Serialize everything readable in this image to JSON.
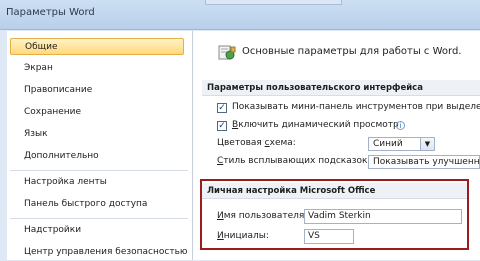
{
  "window": {
    "title": "Параметры Word"
  },
  "sidebar": {
    "items": [
      {
        "label": "Общие",
        "active": true
      },
      {
        "label": "Экран"
      },
      {
        "label": "Правописание"
      },
      {
        "label": "Сохранение"
      },
      {
        "label": "Язык"
      },
      {
        "label": "Дополнительно"
      },
      {
        "label": "Настройка ленты"
      },
      {
        "label": "Панель быстрого доступа"
      },
      {
        "label": "Надстройки"
      },
      {
        "label": "Центр управления безопасностью"
      }
    ]
  },
  "content": {
    "header": "Основные параметры для работы с Word.",
    "ui_group": {
      "title": "Параметры пользовательского интерфейса",
      "mini_toolbar": {
        "label": "Показывать мини-панель инструментов при выделении",
        "checked": true
      },
      "live_preview": {
        "label_pre": "",
        "label_ul": "В",
        "label_post": "ключить динамический просмотр",
        "checked": true
      },
      "color_scheme": {
        "label_pre": "Цветовая ",
        "label_ul": "с",
        "label_post": "хема:",
        "value": "Синий"
      },
      "tooltip_style": {
        "label_pre": "",
        "label_ul": "С",
        "label_post": "тиль всплывающих подсказок:",
        "value": "Показывать улучшенные"
      }
    },
    "office_group": {
      "title": "Личная настройка Microsoft Office",
      "username": {
        "label_pre": "",
        "label_ul": "И",
        "label_post": "мя пользователя:",
        "value": "Vadim Sterkin"
      },
      "initials": {
        "label_pre": "",
        "label_ul": "И",
        "label_post": "нициалы:",
        "value": "VS"
      }
    }
  },
  "colors": {
    "highlight_box": "#9a1c1c",
    "active_nav": "#ffd97a"
  }
}
